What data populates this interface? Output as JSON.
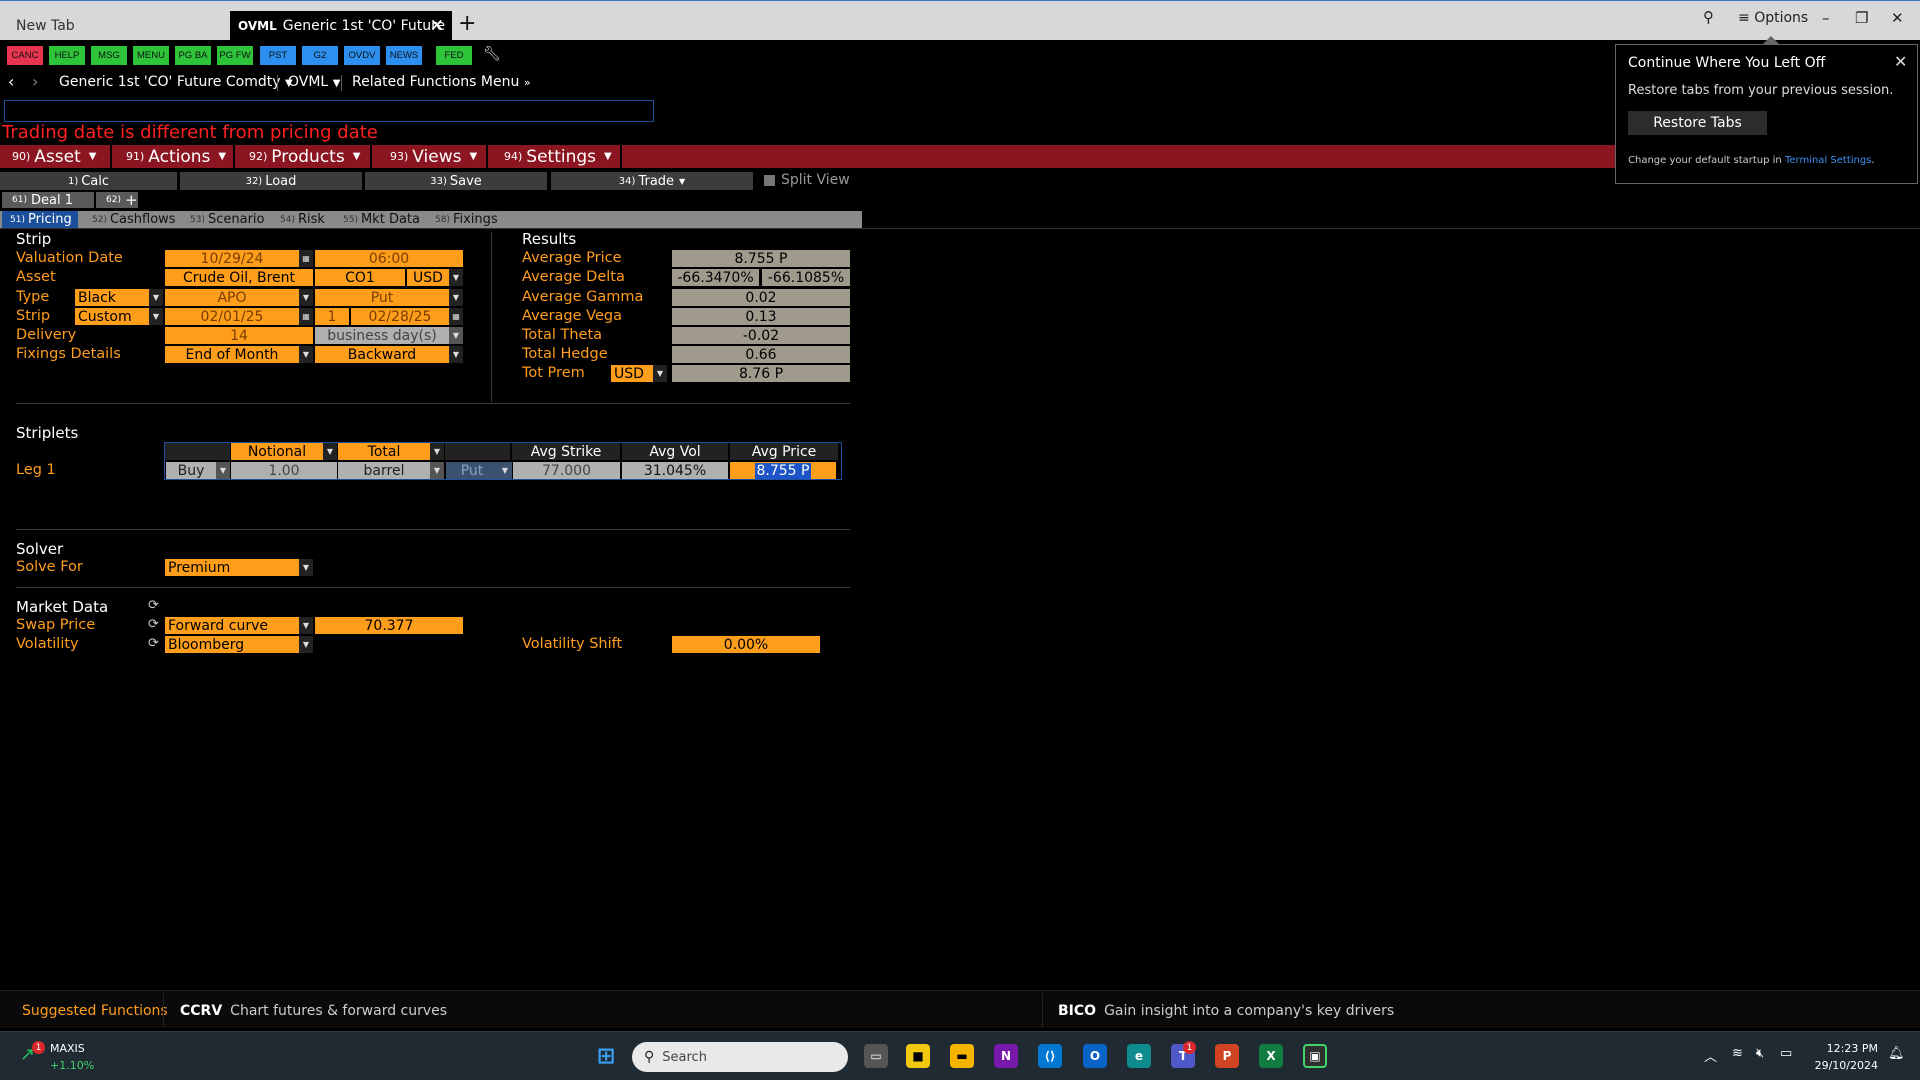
{
  "browser": {
    "tabs": [
      {
        "label": "New Tab"
      },
      {
        "tag": "OVML",
        "label": "Generic 1st 'CO' Future"
      }
    ],
    "new_tab_symbol": "+",
    "options_label": "Options"
  },
  "launchpad": {
    "buttons": [
      {
        "label": "CANC",
        "color": "#e8354f"
      },
      {
        "label": "HELP",
        "color": "#2ec43a"
      },
      {
        "label": "MSG",
        "color": "#2ec43a"
      },
      {
        "label": "MENU",
        "color": "#2ec43a"
      },
      {
        "label": "PG BA",
        "color": "#2ec43a"
      },
      {
        "label": "PG FW",
        "color": "#2ec43a"
      },
      {
        "label": "PST",
        "color": "#2d8ff0"
      },
      {
        "label": "G2",
        "color": "#2d8ff0"
      },
      {
        "label": "OVDV",
        "color": "#2d8ff0"
      },
      {
        "label": "NEWS",
        "color": "#2d8ff0"
      },
      {
        "label": "FED",
        "color": "#2ec43a"
      }
    ]
  },
  "navbar": {
    "security": "Generic 1st 'CO' Future Comdty",
    "function": "OVML",
    "related": "Related Functions Menu"
  },
  "warning": "Trading date is different from pricing date",
  "redmenu": [
    {
      "num": "90)",
      "label": "Asset"
    },
    {
      "num": "91)",
      "label": "Actions"
    },
    {
      "num": "92)",
      "label": "Products"
    },
    {
      "num": "93)",
      "label": "Views"
    },
    {
      "num": "94)",
      "label": "Settings"
    }
  ],
  "buttons": [
    {
      "num": "1)",
      "label": "Calc"
    },
    {
      "num": "32)",
      "label": "Load"
    },
    {
      "num": "33)",
      "label": "Save"
    },
    {
      "num": "34)",
      "label": "Trade"
    }
  ],
  "split_view": "Split View",
  "deal_tabs": [
    {
      "num": "61)",
      "label": "Deal 1"
    },
    {
      "num": "62)",
      "label": "+"
    }
  ],
  "subtabs": [
    {
      "num": "51)",
      "label": "Pricing"
    },
    {
      "num": "52)",
      "label": "Cashflows"
    },
    {
      "num": "53)",
      "label": "Scenario"
    },
    {
      "num": "54)",
      "label": "Risk"
    },
    {
      "num": "55)",
      "label": "Mkt Data"
    },
    {
      "num": "58)",
      "label": "Fixings"
    }
  ],
  "strip": {
    "header": "Strip",
    "valuation_date_label": "Valuation Date",
    "valuation_date": "10/29/24",
    "valuation_time": "06:00",
    "asset_label": "Asset",
    "asset_name": "Crude Oil, Brent",
    "asset_code": "CO1",
    "asset_ccy": "USD",
    "type_label": "Type",
    "type_model": "Black",
    "type_style": "APO",
    "type_callput": "Put",
    "strip_label": "Strip",
    "strip_mode": "Custom",
    "strip_start": "02/01/25",
    "strip_num": "1",
    "strip_end": "02/28/25",
    "delivery_label": "Delivery",
    "delivery_days": "14",
    "delivery_unit": "business day(s)",
    "fixings_label": "Fixings Details",
    "fixings_a": "End of Month",
    "fixings_b": "Backward"
  },
  "results": {
    "header": "Results",
    "avg_price_label": "Average Price",
    "avg_price": "8.755 P",
    "avg_delta_label": "Average Delta",
    "avg_delta_a": "-66.3470%",
    "avg_delta_b": "-66.1085%",
    "avg_gamma_label": "Average Gamma",
    "avg_gamma": "0.02",
    "avg_vega_label": "Average Vega",
    "avg_vega": "0.13",
    "total_theta_label": "Total Theta",
    "total_theta": "-0.02",
    "total_hedge_label": "Total Hedge",
    "total_hedge": "0.66",
    "tot_prem_label": "Tot Prem",
    "tot_prem_ccy": "USD",
    "tot_prem": "8.76 P"
  },
  "striplets": {
    "header": "Striplets",
    "columns": [
      "Notional",
      "Total",
      "Avg Strike",
      "Avg Vol",
      "Avg Price"
    ],
    "leg_label": "Leg 1",
    "side": "Buy",
    "notional": "1.00",
    "unit": "barrel",
    "callput": "Put",
    "avg_strike": "77.000",
    "avg_vol": "31.045%",
    "avg_price": "8.755 P"
  },
  "solver": {
    "header": "Solver",
    "solve_for_label": "Solve For",
    "solve_for": "Premium"
  },
  "market_data": {
    "header": "Market Data",
    "swap_label": "Swap Price",
    "swap_source": "Forward curve",
    "swap_value": "70.377",
    "vol_label": "Volatility",
    "vol_source": "Bloomberg",
    "vol_shift_label": "Volatility Shift",
    "vol_shift": "0.00%"
  },
  "popup": {
    "title": "Continue Where You Left Off",
    "body": "Restore tabs from your previous session.",
    "button": "Restore Tabs",
    "footer_prefix": "Change your default startup in",
    "footer_link": "Terminal Settings",
    "footer_suffix": "."
  },
  "suggested": {
    "label": "Suggested Functions",
    "items": [
      {
        "code": "CCRV",
        "desc": "Chart futures & forward curves"
      },
      {
        "code": "BICO",
        "desc": "Gain insight into a company's key drivers"
      }
    ]
  },
  "taskbar": {
    "ticker": "MAXIS",
    "ticker_change": "+1.10%",
    "ticker_badge": "1",
    "search_placeholder": "Search",
    "time": "12:23 PM",
    "date": "29/10/2024",
    "teams_badge": "1"
  }
}
